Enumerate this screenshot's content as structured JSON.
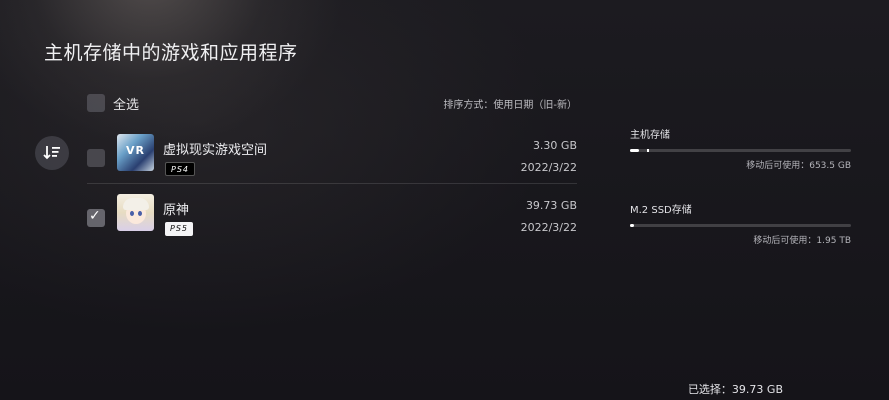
{
  "page": {
    "title": "主机存储中的游戏和应用程序"
  },
  "list": {
    "select_all_label": "全选",
    "sort_label": "排序方式：使用日期（旧-新）",
    "items": [
      {
        "name": "虚拟现实游戏空间",
        "size": "3.30 GB",
        "date": "2022/3/22",
        "platform": "PS4",
        "thumb_text": "VR",
        "checked": false
      },
      {
        "name": "原神",
        "size": "39.73 GB",
        "date": "2022/3/22",
        "platform": "PS5",
        "checked": true
      }
    ]
  },
  "storage": {
    "console": {
      "label": "主机存储",
      "free": "移动后可使用：653.5 GB",
      "used_fraction": 0.02
    },
    "m2": {
      "label": "M.2 SSD存储",
      "free": "移动后可使用：1.95 TB",
      "used_fraction": 0.0
    }
  },
  "footer": {
    "selected_total": "已选择：39.73 GB"
  },
  "icons": {
    "sort": "sort-icon",
    "checkmark": "checkmark-icon"
  }
}
